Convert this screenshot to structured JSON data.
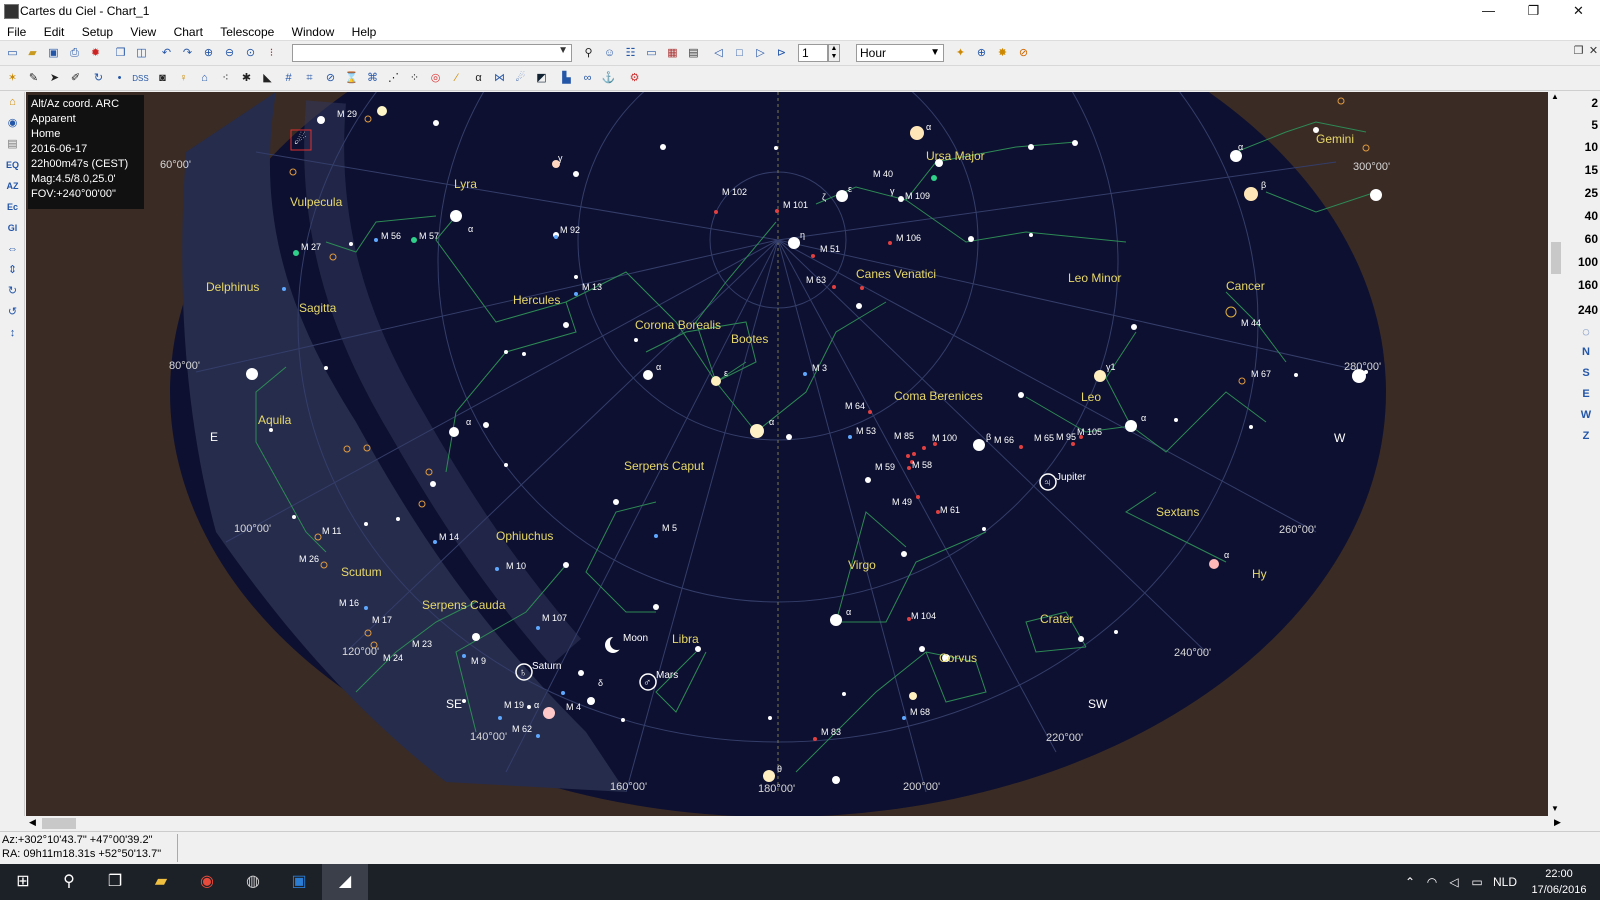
{
  "window": {
    "title": "Cartes du Ciel - Chart_1",
    "minimize_glyph": "—",
    "restore_glyph": "❐",
    "close_glyph": "✕"
  },
  "menu": [
    "File",
    "Edit",
    "Setup",
    "View",
    "Chart",
    "Telescope",
    "Window",
    "Help"
  ],
  "toolbar": {
    "object_search_value": "",
    "step_value": "1",
    "step_unit": "Hour"
  },
  "fov_buttons": [
    "2",
    "5",
    "10",
    "15",
    "25",
    "40",
    "60",
    "100",
    "160",
    "240"
  ],
  "direction_buttons": [
    "N",
    "S",
    "E",
    "W",
    "Z"
  ],
  "left_toolbar_labels": [
    "EQ",
    "AZ",
    "Ec",
    "Gl"
  ],
  "info": [
    "Alt/Az coord. ARC",
    "Apparent",
    "Home",
    "2016-06-17",
    "22h00m47s (CEST)",
    "Mag:4.5/8.0,25.0'",
    "FOV:+240°00'00\""
  ],
  "constellations": [
    "Vulpecula",
    "Lyra",
    "Delphinus",
    "Sagitta",
    "Hercules",
    "Corona Borealis",
    "Bootes",
    "Canes Venatici",
    "Ursa Major",
    "Leo Minor",
    "Cancer",
    "Gemini",
    "Aquila",
    "Coma Berenices",
    "Leo",
    "Serpens Caput",
    "Ophiuchus",
    "Scutum",
    "Serpens Cauda",
    "Libra",
    "Virgo",
    "Sextans",
    "Crater",
    "Corvus",
    "Hy"
  ],
  "messier": [
    "M 29",
    "M 27",
    "M 56",
    "M 57",
    "M 92",
    "M 13",
    "M 102",
    "M 101",
    "M 51",
    "M 106",
    "M 40",
    "M 109",
    "M 63",
    "M 44",
    "M 67",
    "M 3",
    "M 64",
    "M 53",
    "M 85",
    "M 100",
    "M 66",
    "M 65",
    "M 95",
    "M 105",
    "M 59",
    "M 58",
    "M 49",
    "M 61",
    "M 5",
    "M 11",
    "M 14",
    "M 26",
    "M 10",
    "M 16",
    "M 17",
    "M 107",
    "M 23",
    "M 24",
    "M 9",
    "M 104",
    "M 19",
    "M 4",
    "M 62",
    "M 68",
    "M 83"
  ],
  "planets": [
    "Jupiter",
    "Moon",
    "Saturn",
    "Mars"
  ],
  "greek": [
    "α",
    "β",
    "γ",
    "δ",
    "ε",
    "ζ",
    "η",
    "θ",
    "γ1"
  ],
  "azimuth_labels": [
    "60°00'",
    "80°00'",
    "100°00'",
    "120°00'",
    "140°00'",
    "160°00'",
    "180°00'",
    "200°00'",
    "220°00'",
    "240°00'",
    "260°00'",
    "280°00'",
    "300°00'"
  ],
  "cardinal_labels": [
    "E",
    "SE",
    "SW",
    "W"
  ],
  "status": {
    "line1": "Az:+302°10'43.7\" +47°00'39.2\"",
    "line2": "RA: 09h11m18.31s +52°50'13.7\""
  },
  "taskbar": {
    "time": "22:00",
    "date": "17/06/2016",
    "lang": "NLD"
  },
  "colors": {
    "sky": "#0d1030",
    "ground": "#3a2b25",
    "milkyway": "#2a3050",
    "constellation_line": "#2d8a55",
    "constellation_label": "#e8d96a",
    "grid": "#3a4470",
    "messier": "#e04040"
  }
}
